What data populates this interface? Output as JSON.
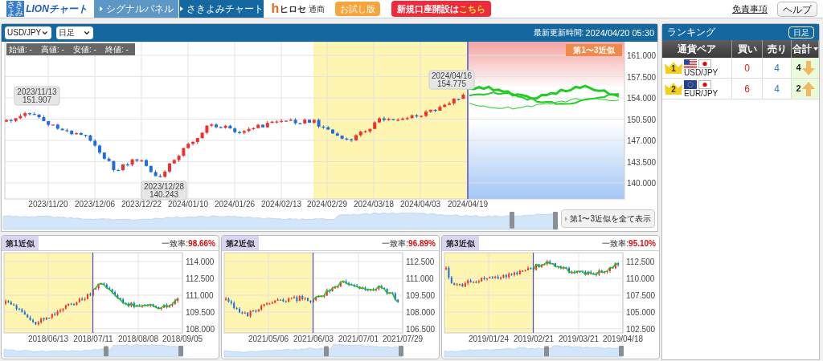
{
  "header": {
    "logo": {
      "badge": "さきよみ",
      "name": "LIONチャート"
    },
    "tabs": [
      {
        "label": "シグナルパネル",
        "selected": false
      },
      {
        "label": "さきよみチャート",
        "selected": true
      }
    ],
    "broker": {
      "mark": "h",
      "name": "ヒロセ",
      "suffix": "通商"
    },
    "trial_badge": "お試し版",
    "signup_button": {
      "text": "新規口座開設は",
      "highlight": "こちら"
    },
    "disclaimer_link": "免責事項",
    "help_button": "ヘルプ"
  },
  "main_chart": {
    "pair_select": "USD/JPY",
    "period_select": "日足",
    "updated_label": "最新更新時間:",
    "updated_value": "2024/04/20 05:30",
    "ohlc": [
      {
        "label": "始値:",
        "value": "-"
      },
      {
        "label": "高値:",
        "value": "-"
      },
      {
        "label": "安値:",
        "value": "-"
      },
      {
        "label": "終値:",
        "value": "-"
      }
    ],
    "yticks": [
      "161.000",
      "157.500",
      "154.000",
      "150.500",
      "147.000",
      "143.500",
      "140.000"
    ],
    "xlabels": [
      "2023/11/20",
      "2023/12/06",
      "2023/12/22",
      "2024/01/10",
      "2024/01/26",
      "2024/02/13",
      "2024/02/29",
      "2024/03/18",
      "2024/04/03",
      "2024/04/19"
    ],
    "callouts": [
      {
        "date": "2023/11/13",
        "price": "151.907"
      },
      {
        "date": "2023/12/28",
        "price": "140.243"
      },
      {
        "date": "2024/04/16",
        "price": "154.775"
      }
    ],
    "forecast_badge": "第1〜3近似",
    "show_all_button": "第1〜3近似を全て表示"
  },
  "ranking": {
    "title": "ランキング",
    "period_button": "日足",
    "columns": [
      {
        "label": "通貨ペア",
        "sorted": false
      },
      {
        "label": "買い",
        "sorted": false
      },
      {
        "label": "売り",
        "sorted": false
      },
      {
        "label": "合計",
        "sorted": true
      }
    ],
    "rows": [
      {
        "rank": "1",
        "flags": [
          {
            "kind": "us"
          },
          {
            "kind": "jp"
          }
        ],
        "pair": "USD/JPY",
        "buy": "0",
        "sell": "4",
        "total": "4",
        "arrow": {
          "kind": "down"
        }
      },
      {
        "rank": "2",
        "flags": [
          {
            "kind": "eu"
          },
          {
            "kind": "jp"
          }
        ],
        "pair": "EUR/JPY",
        "buy": "6",
        "sell": "4",
        "total": "2",
        "arrow": {
          "kind": "up"
        }
      }
    ]
  },
  "similar_charts": [
    {
      "title": "第1近似",
      "match_label": "一致率:",
      "match_value": "98.66%",
      "yticks": [
        "114.000",
        "112.500",
        "111.000",
        "109.500",
        "108.000"
      ],
      "xlabels": [
        "2018/06/13",
        "2018/07/11",
        "2018/08/08",
        "2018/09/05"
      ]
    },
    {
      "title": "第2近似",
      "match_label": "一致率:",
      "match_value": "96.89%",
      "yticks": [
        "112.500",
        "111.000",
        "109.500",
        "108.000",
        "106.500"
      ],
      "xlabels": [
        "2021/05/06",
        "2021/06/03",
        "2021/07/01",
        "2021/07/29"
      ]
    },
    {
      "title": "第3近似",
      "match_label": "一致率:",
      "match_value": "95.10%",
      "yticks": [
        "112.500",
        "110.000",
        "107.500",
        "105.000",
        "102.500"
      ],
      "xlabels": [
        "2019/01/24",
        "2019/02/21",
        "2019/03/21",
        "2019/04/18"
      ]
    }
  ]
}
